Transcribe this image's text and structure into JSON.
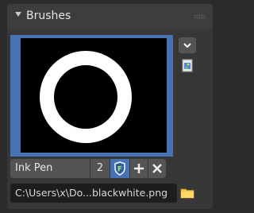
{
  "panel": {
    "title": "Brushes"
  },
  "brush": {
    "name": "Ink Pen",
    "users": "2",
    "fake_user_icon": "shield-f-icon",
    "add_icon": "plus-icon",
    "remove_icon": "close-icon"
  },
  "image": {
    "path": "C:\\Users\\x\\Do...blackwhite.png",
    "browse_icon": "folder-icon"
  },
  "colors": {
    "accent": "#4772b3",
    "panel_bg": "#373737",
    "field_bg": "#545454",
    "path_bg": "#1d1d1d"
  }
}
